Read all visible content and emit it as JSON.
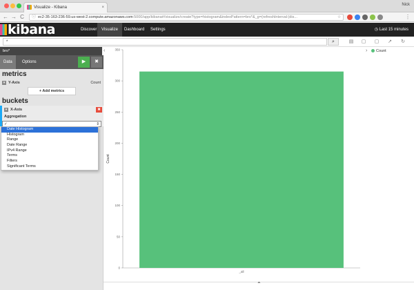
{
  "browser": {
    "tab_title": "Visualize - Kibana",
    "tab_close": "×",
    "profile_name": "Nick",
    "nav_back": "←",
    "nav_forward": "→",
    "nav_reload": "C",
    "url_main": "ec2-35-163-236-59.us-west-2.compute.amazonaws.com",
    "url_rest": ":5000/app/kibana#/visualize/create?type=histogram&indexPattern=bro*&_g=(refreshInterval:(dis...",
    "lock_glyph": "ⓘ",
    "star_glyph": "☆",
    "extension_colors": [
      "#e64a3b",
      "#3a83f1",
      "#666666",
      "#8bc34a",
      "#888888"
    ]
  },
  "kibana_nav": {
    "logo_text": "kibana",
    "links": [
      "Discover",
      "Visualize",
      "Dashboard",
      "Settings"
    ],
    "active_link": "Visualize",
    "time_label": "Last 15 minutes",
    "clock_glyph": "◷"
  },
  "search": {
    "query": "*",
    "search_glyph": "⌕",
    "toolbar_glyphs": [
      "▤",
      "▢",
      "▢",
      "↗",
      "↻"
    ]
  },
  "index_pattern": "bro*",
  "sidebar": {
    "tabs": [
      "Data",
      "Options"
    ],
    "active_tab": "Data",
    "apply_glyph": "▶",
    "discard_glyph": "✖",
    "metrics_title": "metrics",
    "metric_row": {
      "toggle": "▾",
      "label": "Y-Axis",
      "value": "Count"
    },
    "add_metrics_label": "+ Add metrics",
    "buckets_title": "buckets",
    "bucket_row": {
      "toggle": "▾",
      "label": "X-Axis"
    },
    "remove_glyph": "✖",
    "aggregation_label": "Aggregation",
    "select_value": "✓",
    "select_caret": "⇕",
    "aggregation_options": [
      "Date Histogram",
      "Histogram",
      "Range",
      "Date Range",
      "IPv4 Range",
      "Terms",
      "Filters",
      "Significant Terms"
    ],
    "selected_option": "Date Histogram"
  },
  "collapse_left": "‹",
  "collapse_right": "›",
  "bottom_toggle": "⌃",
  "colors": {
    "bar": "#57c17b",
    "nav_bg": "#222222",
    "apply": "#4caf50",
    "remove": "#e74c3c",
    "selected": "#2c71d8"
  },
  "chart_data": {
    "type": "bar",
    "categories": [
      "_all"
    ],
    "series": [
      {
        "name": "Count",
        "values": [
          315
        ]
      }
    ],
    "ylabel": "Count",
    "xlabel": "",
    "ylim": [
      0,
      350
    ],
    "yticks": [
      0,
      50,
      100,
      150,
      200,
      250,
      300,
      350
    ],
    "grid": false,
    "legend": "top-right",
    "legend_label": "Count"
  }
}
